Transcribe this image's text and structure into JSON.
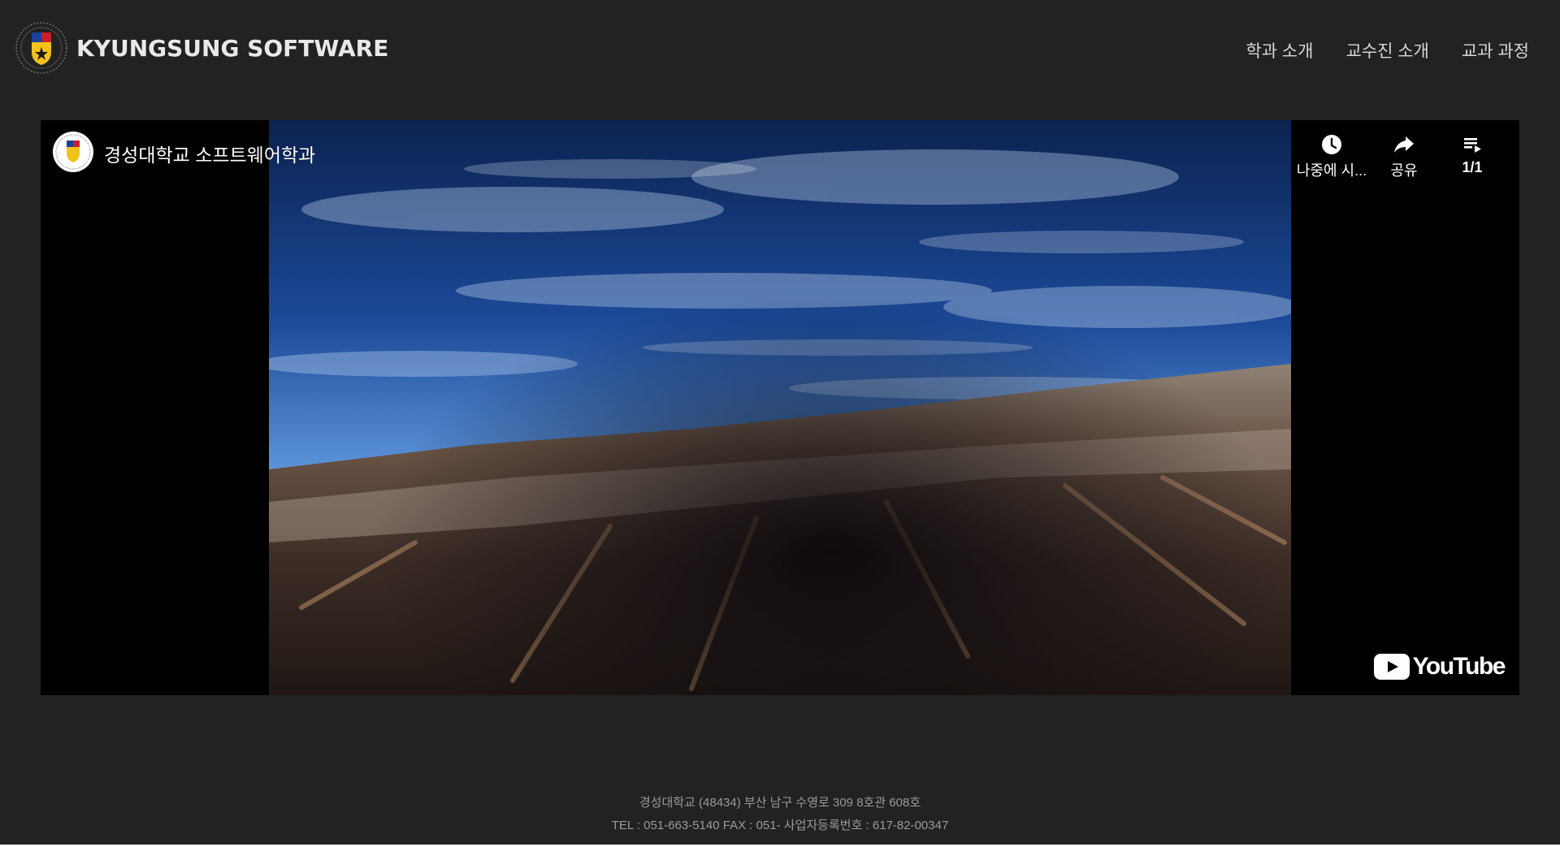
{
  "header": {
    "brand_title": "KYUNGSUNG SOFTWARE",
    "logo_icon": "university-emblem-icon",
    "nav": [
      {
        "label": "학과 소개"
      },
      {
        "label": "교수진 소개"
      },
      {
        "label": "교과 과정"
      }
    ]
  },
  "video": {
    "title": "경성대학교 소프트웨어학과",
    "channel_avatar_icon": "channel-avatar-icon",
    "actions": [
      {
        "label": "나중에 시...",
        "icon": "clock-icon"
      },
      {
        "label": "공유",
        "icon": "share-icon"
      },
      {
        "label": "1/1",
        "icon": "playlist-icon"
      }
    ],
    "logo_word": "YouTube",
    "colors": {
      "youtube_play": "#ffffff",
      "sky_top": "#0f2c63",
      "sky_horizon": "#7fb0e8",
      "ground": "#5a4436"
    }
  },
  "footer": {
    "address": "경성대학교 (48434) 부산 남구 수영로 309 8호관 608호",
    "contact": "TEL : 051-663-5140 FAX : 051- 사업자등록번호 : 617-82-00347"
  },
  "colors": {
    "background": "#222222",
    "brand_text": "#e9e9e9",
    "nav_text": "#d6d6d6",
    "footer_text": "#9a9a9a"
  }
}
